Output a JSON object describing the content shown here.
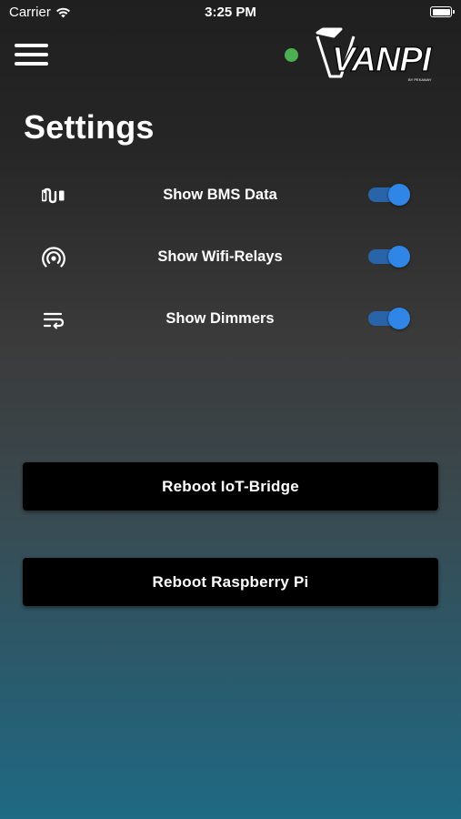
{
  "status_bar": {
    "carrier": "Carrier",
    "time": "3:25 PM"
  },
  "header": {
    "menu_icon": "hamburger-menu-icon",
    "connection_status": "connected",
    "connection_color": "#4caf50",
    "logo_text": "VANPI",
    "logo_subtext": "BY PEKAWAY"
  },
  "page": {
    "title": "Settings"
  },
  "settings": [
    {
      "icon": "battery-bms-icon",
      "label": "Show BMS Data",
      "enabled": true
    },
    {
      "icon": "wifi-relay-icon",
      "label": "Show Wifi-Relays",
      "enabled": true
    },
    {
      "icon": "dimmer-icon",
      "label": "Show Dimmers",
      "enabled": true
    }
  ],
  "actions": {
    "reboot_iot_bridge": "Reboot IoT-Bridge",
    "reboot_raspberry_pi": "Reboot Raspberry Pi"
  },
  "colors": {
    "toggle_track": "#2a64a8",
    "toggle_knob": "#2f86e6",
    "button_bg": "#000000"
  }
}
